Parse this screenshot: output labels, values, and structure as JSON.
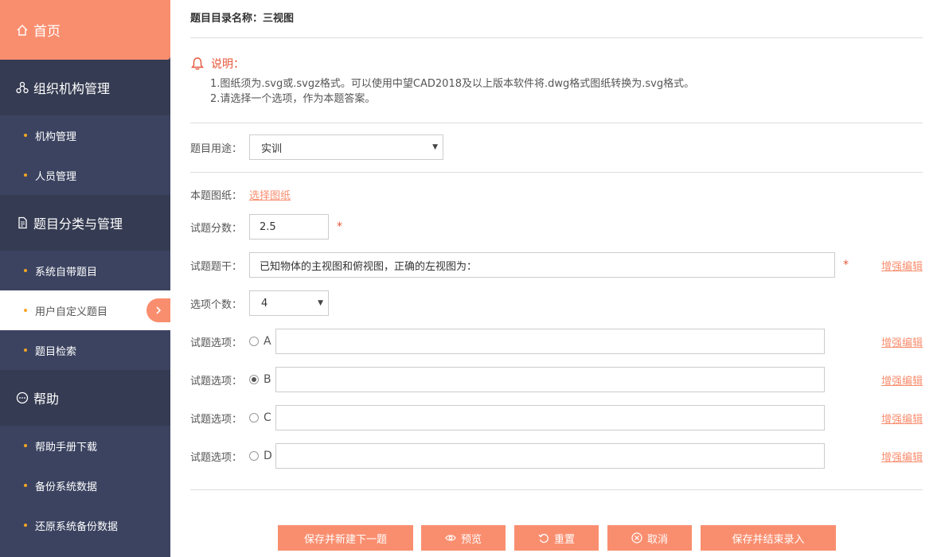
{
  "sidebar": {
    "home_label": "首页",
    "sections": [
      {
        "title": "组织机构管理",
        "items": [
          "机构管理",
          "人员管理"
        ]
      },
      {
        "title": "题目分类与管理",
        "items": [
          "系统自带题目",
          "用户自定义题目",
          "题目检索"
        ]
      },
      {
        "title": "帮助",
        "items": [
          "帮助手册下载",
          "备份系统数据",
          "还原系统备份数据"
        ]
      }
    ],
    "active_item": "用户自定义题目"
  },
  "main": {
    "catalog_title": "题目目录名称：三视图",
    "notice": {
      "heading": "说明：",
      "lines": [
        "1.图纸须为.svg或.svgz格式。可以使用中望CAD2018及以上版本软件将.dwg格式图纸转换为.svg格式。",
        "2.请选择一个选项，作为本题答案。"
      ]
    },
    "purpose": {
      "label": "题目用途：",
      "value": "实训"
    },
    "drawing": {
      "label": "本题图纸：",
      "link": "选择图纸"
    },
    "score": {
      "label": "试题分数：",
      "value": "2.5",
      "required": "*"
    },
    "stem": {
      "label": "试题题干：",
      "value": "已知物体的主视图和俯视图，正确的左视图为：",
      "required": "*",
      "enhance": "增强编辑"
    },
    "option_count": {
      "label": "选项个数：",
      "value": "4"
    },
    "options": [
      {
        "label": "试题选项：",
        "letter": "A",
        "checked": false,
        "value": "",
        "enhance": "增强编辑"
      },
      {
        "label": "试题选项：",
        "letter": "B",
        "checked": true,
        "value": "",
        "enhance": "增强编辑"
      },
      {
        "label": "试题选项：",
        "letter": "C",
        "checked": false,
        "value": "",
        "enhance": "增强编辑"
      },
      {
        "label": "试题选项：",
        "letter": "D",
        "checked": false,
        "value": "",
        "enhance": "增强编辑"
      }
    ]
  },
  "buttons": {
    "save_new": "保存并新建下一题",
    "preview": "预览",
    "reset": "重置",
    "cancel": "取消",
    "save_finish": "保存并结束录入"
  },
  "colors": {
    "accent": "#f98e6f",
    "sidebar_bg": "#3b4360",
    "sidebar_head": "#353b52",
    "dot": "#f5a623",
    "required": "#e4553a"
  }
}
